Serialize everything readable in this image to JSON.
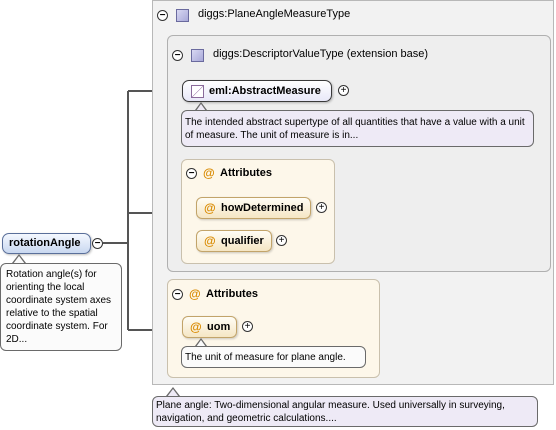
{
  "root_element": {
    "name": "rotationAngle",
    "doc": "Rotation angle(s) for orienting the local coordinate system axes relative to the spatial coordinate system. For 2D..."
  },
  "type": {
    "name": "diggs:PlaneAngleMeasureType",
    "doc": "Plane angle: Two-dimensional angular measure. Used universally in surveying, navigation, and geometric calculations...."
  },
  "extension": {
    "name": "diggs:DescriptorValueType (extension base)",
    "abstract_element": {
      "name": "eml:AbstractMeasure",
      "doc": "The intended abstract supertype of all quantities that have a value with a unit of measure. The unit of measure is in..."
    },
    "attributes": {
      "label": "Attributes",
      "items": [
        {
          "name": "howDetermined"
        },
        {
          "name": "qualifier"
        }
      ]
    }
  },
  "own_attributes": {
    "label": "Attributes",
    "items": [
      {
        "name": "uom",
        "doc": "The unit of measure for plane angle."
      }
    ]
  },
  "icons": {
    "collapse": "minus-circle-icon",
    "expand": "plus-circle-icon",
    "complex_type": "complex-type-icon",
    "attribute": "attribute-at-icon",
    "abstract": "abstract-element-icon"
  },
  "colors": {
    "type_box": "#f2f2f2",
    "attribute_group": "#fdf7ea",
    "attribute_node": "#f5e6c4",
    "root_node": "#c9d8f0",
    "doc_purple": "#eeeaf6"
  }
}
